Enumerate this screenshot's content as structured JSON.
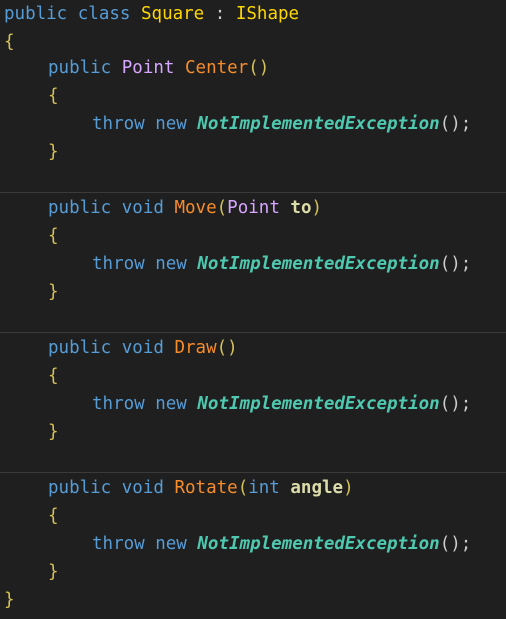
{
  "code": {
    "class_decl": {
      "kw_public": "public",
      "kw_class": "class",
      "class_name": "Square",
      "colon": ":",
      "interface": "IShape"
    },
    "open_brace": "{",
    "close_brace": "}",
    "methods": [
      {
        "kw_public": "public",
        "return_type": "Point",
        "name": "Center",
        "open_paren": "(",
        "params_type": "",
        "params_name": "",
        "close_paren": ")",
        "body_open": "{",
        "kw_throw": "throw",
        "kw_new": "new",
        "exception": "NotImplementedException",
        "call_end": "();",
        "body_close": "}"
      },
      {
        "kw_public": "public",
        "return_type": "void",
        "name": "Move",
        "open_paren": "(",
        "params_type": "Point",
        "params_name": "to",
        "close_paren": ")",
        "body_open": "{",
        "kw_throw": "throw",
        "kw_new": "new",
        "exception": "NotImplementedException",
        "call_end": "();",
        "body_close": "}"
      },
      {
        "kw_public": "public",
        "return_type": "void",
        "name": "Draw",
        "open_paren": "(",
        "params_type": "",
        "params_name": "",
        "close_paren": ")",
        "body_open": "{",
        "kw_throw": "throw",
        "kw_new": "new",
        "exception": "NotImplementedException",
        "call_end": "();",
        "body_close": "}"
      },
      {
        "kw_public": "public",
        "return_type": "void",
        "name": "Rotate",
        "open_paren": "(",
        "params_type": "int",
        "params_name": "angle",
        "close_paren": ")",
        "body_open": "{",
        "kw_throw": "throw",
        "kw_new": "new",
        "exception": "NotImplementedException",
        "call_end": "();",
        "body_close": "}"
      }
    ]
  },
  "colors": {
    "background": "#1f1f1f",
    "keyword": "#569cd6",
    "class_name": "#ffd700",
    "method_name": "#f78c2a",
    "exception_type": "#4ec9b0",
    "parameter": "#dcdcaa"
  }
}
